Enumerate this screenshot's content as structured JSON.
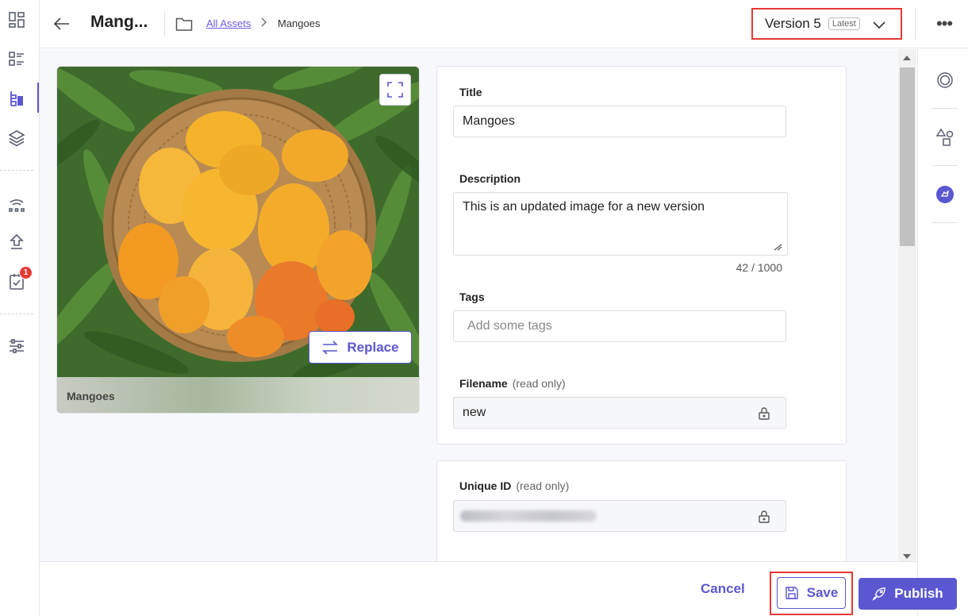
{
  "header": {
    "title": "Mang...",
    "breadcrumb_link": "All Assets",
    "breadcrumb_separator": ">",
    "breadcrumb_current": "Mangoes",
    "version_label": "Version 5",
    "version_chip": "Latest"
  },
  "nav": {
    "badge_count": "1"
  },
  "asset": {
    "caption": "Mangoes",
    "replace_label": "Replace"
  },
  "form": {
    "title_label": "Title",
    "title_value": "Mangoes",
    "description_label": "Description",
    "description_value": "This is an updated image for a new version",
    "description_counter": "42 / 1000",
    "tags_label": "Tags",
    "tags_placeholder": "Add some tags",
    "filename_label": "Filename",
    "filename_suffix": "(read only)",
    "filename_value": "new",
    "unique_id_label": "Unique ID",
    "unique_id_suffix": "(read only)"
  },
  "footer": {
    "cancel_label": "Cancel",
    "save_label": "Save",
    "publish_label": "Publish"
  },
  "colors": {
    "accent": "#5b57d1",
    "highlight": "#e53935"
  }
}
